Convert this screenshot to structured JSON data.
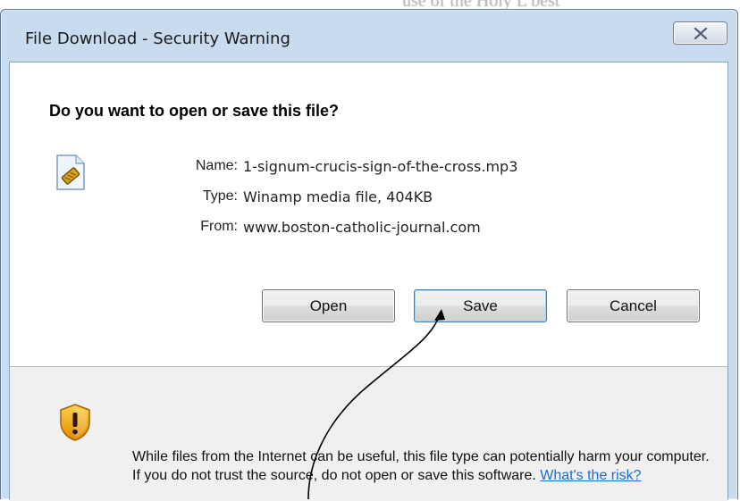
{
  "background": {
    "partial_text": "use of the Holy L best"
  },
  "window": {
    "title": "File Download - Security Warning",
    "close_label": "Close"
  },
  "dialog": {
    "question": "Do you want to open or save this file?",
    "file_icon": "mp3-file-icon",
    "fields": [
      {
        "label": "Name:",
        "value": "1-signum-crucis-sign-of-the-cross.mp3"
      },
      {
        "label": "Type:",
        "value": "Winamp media file, 404KB"
      },
      {
        "label": "From:",
        "value": "www.boston-catholic-journal.com"
      }
    ],
    "buttons": {
      "open": "Open",
      "save": "Save",
      "cancel": "Cancel"
    },
    "warning": {
      "icon": "warning-shield-icon",
      "text": "While files from the Internet can be useful, this file type can potentially harm your computer. If you do not trust the source, do not open or save this software.",
      "link": "What's the risk?"
    }
  },
  "colors": {
    "frame": "#c9dcef",
    "link": "#1f6bc4",
    "warning_bg": "#f0f0f0"
  }
}
